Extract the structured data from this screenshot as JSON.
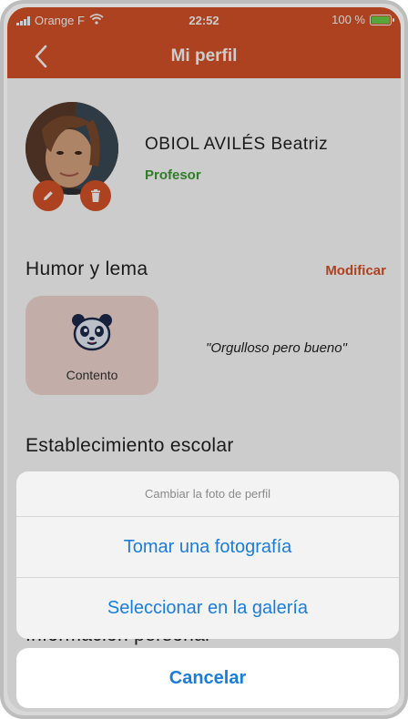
{
  "status_bar": {
    "carrier": "Orange F",
    "time": "22:52",
    "battery": "100 %"
  },
  "header": {
    "title": "Mi perfil"
  },
  "profile": {
    "name": "OBIOL AVILÉS Beatriz",
    "role": "Profesor"
  },
  "mood": {
    "section_title": "Humor y lema",
    "modify_label": "Modificar",
    "mood_label": "Contento",
    "motto": "\"Orgulloso pero bueno\""
  },
  "school": {
    "section_title": "Establecimiento escolar"
  },
  "info": {
    "section_title": "Información personal"
  },
  "action_sheet": {
    "title": "Cambiar la foto de perfil",
    "options": [
      "Tomar una fotografía",
      "Seleccionar en la galería"
    ],
    "cancel_label": "Cancelar"
  },
  "colors": {
    "accent": "#d9532a",
    "role_green": "#3f9b35",
    "ios_blue": "#1a7ddb"
  }
}
